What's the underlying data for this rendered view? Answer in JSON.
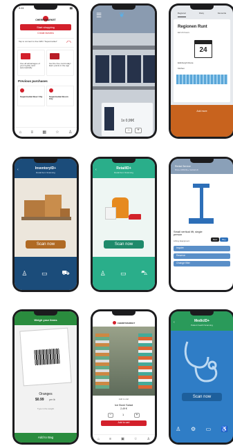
{
  "status": {
    "time": "9:41"
  },
  "s1": {
    "brand": "CHERRYMARKET",
    "start": "Start shopping",
    "list": "Create list/view",
    "wifi": "Tap to connect to free WiFi \"Supermarket\"",
    "card1": "Use all advantages of your loyalty card automatically",
    "card2": "Get the free card today! Earn points in the app",
    "prev": "Previous purchases",
    "p1": "Supermarket Beer City",
    "p2": "Supermarket Boom City"
  },
  "s2": {
    "price": "1x 0,99€",
    "minus": "−",
    "plus": "+"
  },
  "s3": {
    "tabs": [
      "Regional",
      "Diary",
      "Favourite"
    ],
    "title": "Regionen Runt",
    "meta": "Eid 24 hours",
    "day": "24",
    "sub": "Edinburgh Route",
    "kitchen": "Kitchen",
    "foot": "Add more"
  },
  "s4": {
    "title": "InventoryID+",
    "sub": "Retail Item Scanning",
    "scan": "Scan now"
  },
  "s5": {
    "title": "RetailID+",
    "sub": "Retail Item Scanning",
    "scan": "Scan now"
  },
  "s6": {
    "header": "Rental Service",
    "crumbs": "Shop ▸ MANUAL ▸ Vertical Lift",
    "name": "Small vertical lift, single person",
    "cat": "Lifting Equipment",
    "tags": [
      "Rent",
      "Buy"
    ],
    "actions": [
      "Inquire",
      "Reserve",
      "Change filter"
    ]
  },
  "s7": {
    "header": "Weigh your items",
    "item": "Oranges",
    "price": "$0.99",
    "unit": "per lb",
    "type": "Type in the weight",
    "add": "Add to Bag"
  },
  "s8": {
    "brand": "CHERRYMARKET",
    "cart": "Add to cart",
    "product": "Ice Bowl Salad",
    "price": "2,49 €",
    "qty": "1",
    "addcart": "Add to cart"
  },
  "s9": {
    "title": "MedicID+",
    "sub": "Patient health Scanning",
    "scan": "Scan now"
  },
  "colors": {
    "red": "#d3202b",
    "navy": "#1b4c7a",
    "teal": "#2aae8a",
    "green": "#2a8c3e",
    "med": "#2f7dc6"
  }
}
